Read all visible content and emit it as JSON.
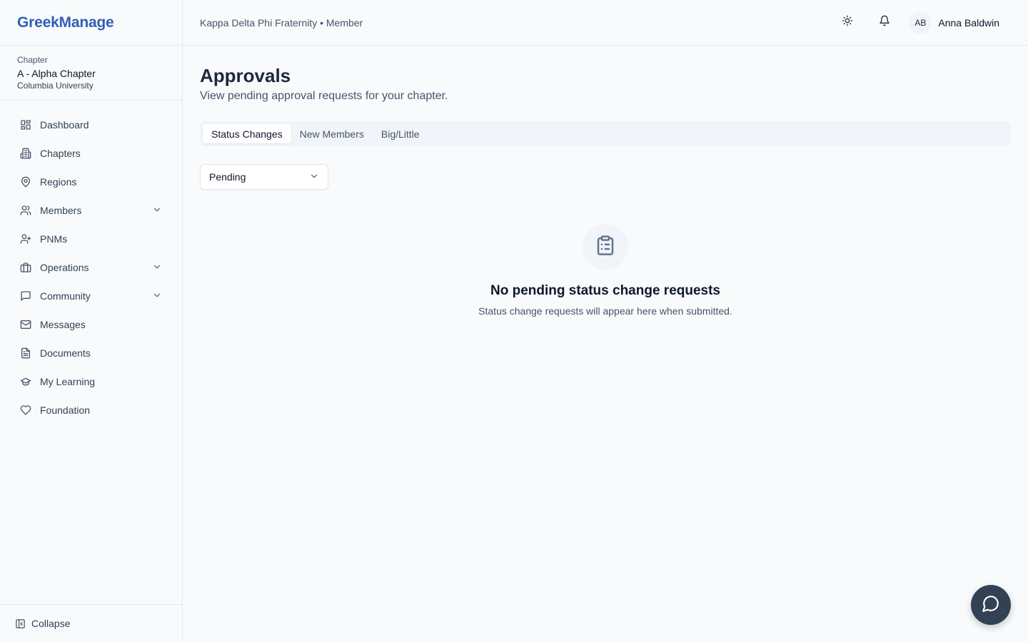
{
  "brand": {
    "name": "GreekManage",
    "color": "#2f5fb3"
  },
  "chapter": {
    "label": "Chapter",
    "name": "A - Alpha Chapter",
    "university": "Columbia University"
  },
  "sidebar": {
    "items": [
      {
        "label": "Dashboard",
        "icon": "dashboard-icon"
      },
      {
        "label": "Chapters",
        "icon": "building-icon"
      },
      {
        "label": "Regions",
        "icon": "map-pin-icon"
      },
      {
        "label": "Members",
        "icon": "users-icon",
        "expandable": true
      },
      {
        "label": "PNMs",
        "icon": "user-plus-icon"
      },
      {
        "label": "Operations",
        "icon": "briefcase-icon",
        "expandable": true
      },
      {
        "label": "Community",
        "icon": "chat-icon",
        "expandable": true
      },
      {
        "label": "Messages",
        "icon": "mail-icon"
      },
      {
        "label": "Documents",
        "icon": "document-icon"
      },
      {
        "label": "My Learning",
        "icon": "graduation-cap-icon"
      },
      {
        "label": "Foundation",
        "icon": "heart-icon"
      }
    ],
    "collapse_label": "Collapse"
  },
  "header": {
    "breadcrumb": "Kappa Delta Phi Fraternity • Member",
    "user": {
      "initials": "AB",
      "name": "Anna Baldwin"
    }
  },
  "main": {
    "title": "Approvals",
    "subtitle": "View pending approval requests for your chapter.",
    "tabs": [
      {
        "label": "Status Changes",
        "active": true
      },
      {
        "label": "New Members",
        "active": false
      },
      {
        "label": "Big/Little",
        "active": false
      }
    ],
    "filter": {
      "value": "Pending"
    },
    "empty_state": {
      "title": "No pending status change requests",
      "message": "Status change requests will appear here when submitted."
    }
  }
}
